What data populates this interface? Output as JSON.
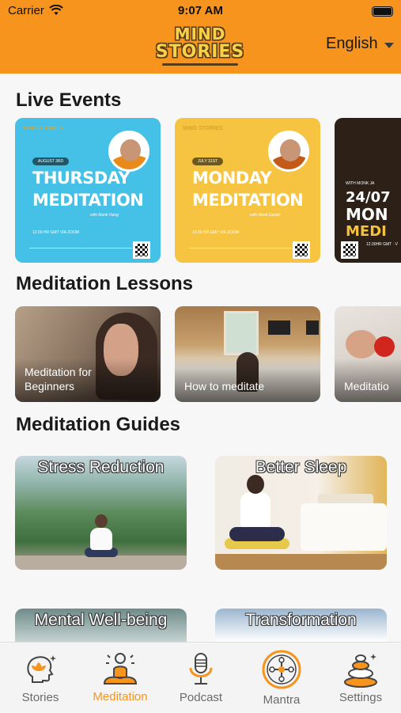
{
  "status_bar": {
    "carrier": "Carrier",
    "time": "9:07 AM"
  },
  "header": {
    "logo_line1": "MIND",
    "logo_line2": "STORIES",
    "language": "English"
  },
  "sections": {
    "live_events": "Live Events",
    "lessons": "Meditation Lessons",
    "guides": "Meditation Guides"
  },
  "live_events": [
    {
      "mini_logo": "MIND STORIES",
      "date": "AUGUST 3RD",
      "line1": "THURSDAY",
      "line2": "MEDITATION",
      "host": "with Monk Hang",
      "time": "12.00 HR GMT VIA ZOOM"
    },
    {
      "mini_logo": "MIND STORIES",
      "date": "JULY 31ST",
      "line1": "MONDAY",
      "line2": "MEDITATION",
      "host": "with Monk Daniel",
      "time": "12.00 HR GMT VIA ZOOM"
    },
    {
      "with": "WITH MONK JA",
      "line1": "24/07",
      "line2": "MON",
      "line3": "MEDI",
      "time": "12.00HR GMT · V"
    }
  ],
  "lessons": [
    {
      "caption": "Meditation for Beginners"
    },
    {
      "caption": "How to meditate"
    },
    {
      "caption": "Meditatio"
    }
  ],
  "guides": [
    {
      "title": "Stress Reduction"
    },
    {
      "title": "Better Sleep"
    },
    {
      "title": "Mental Well-being"
    },
    {
      "title": "Transformation"
    }
  ],
  "tabs": [
    {
      "label": "Stories",
      "icon": "head-lotus-icon",
      "active": false
    },
    {
      "label": "Meditation",
      "icon": "meditating-person-icon",
      "active": true
    },
    {
      "label": "Podcast",
      "icon": "microphone-icon",
      "active": false
    },
    {
      "label": "Mantra",
      "icon": "mandala-icon",
      "active": false
    },
    {
      "label": "Settings",
      "icon": "stacked-stones-icon",
      "active": false
    }
  ],
  "colors": {
    "accent": "#f7941d",
    "header_bg": "#f7941d",
    "tab_inactive": "#6a6a6a",
    "background": "#f7f7f7"
  }
}
